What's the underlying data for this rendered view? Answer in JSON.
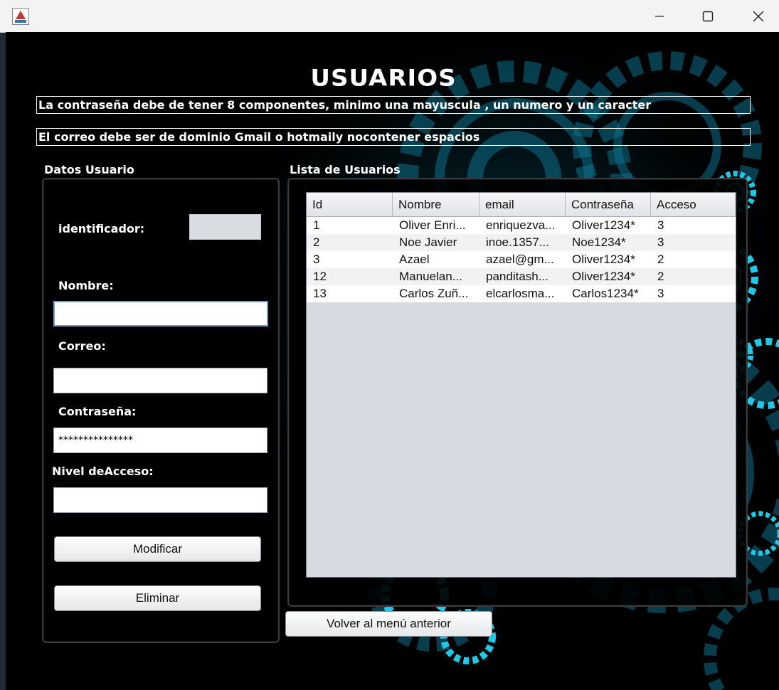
{
  "window": {
    "icon": "java-app-icon",
    "controls": [
      "minimize-icon",
      "maximize-icon",
      "close-icon"
    ]
  },
  "heading": "USUARIOS",
  "rules": {
    "password": "La contraseña debe de tener 8 componentes, minimo una mayuscula , un numero y un caracter",
    "email": "El correo debe ser de dominio Gmail o hotmaily nocontener espacios"
  },
  "datos_usuario": {
    "title": "Datos Usuario",
    "id_label": "identificador:",
    "id_value": "",
    "nombre_label": "Nombre:",
    "nombre_value": "",
    "correo_label": "Correo:",
    "correo_value": "",
    "password_label": "Contraseña:",
    "password_value": "***************",
    "acceso_label": "Nivel deAcceso:",
    "acceso_value": "",
    "modificar_label": "Modificar",
    "eliminar_label": "Eliminar"
  },
  "lista": {
    "title": "Lista de Usuarios",
    "columns": [
      "Id",
      "Nombre",
      "email",
      "Contraseña",
      "Acceso"
    ],
    "rows": [
      [
        "1",
        "Oliver Enri...",
        "enriquezva...",
        "Oliver1234*",
        "3"
      ],
      [
        "2",
        "Noe Javier",
        "inoe.1357...",
        "Noe1234*",
        "3"
      ],
      [
        "3",
        "Azael",
        "azael@gm...",
        "Oliver1234*",
        "2"
      ],
      [
        "12",
        "Manuelan...",
        "panditash...",
        "Oliver1234*",
        "2"
      ],
      [
        "13",
        "Carlos Zuñ...",
        "elcarlosma...",
        "Carlos1234*",
        "3"
      ]
    ]
  },
  "volver_label": "Volver al menú anterior",
  "colors": {
    "background": "#000000",
    "gear_accent": "#1ec8e6",
    "table_empty": "#d7dae1"
  }
}
